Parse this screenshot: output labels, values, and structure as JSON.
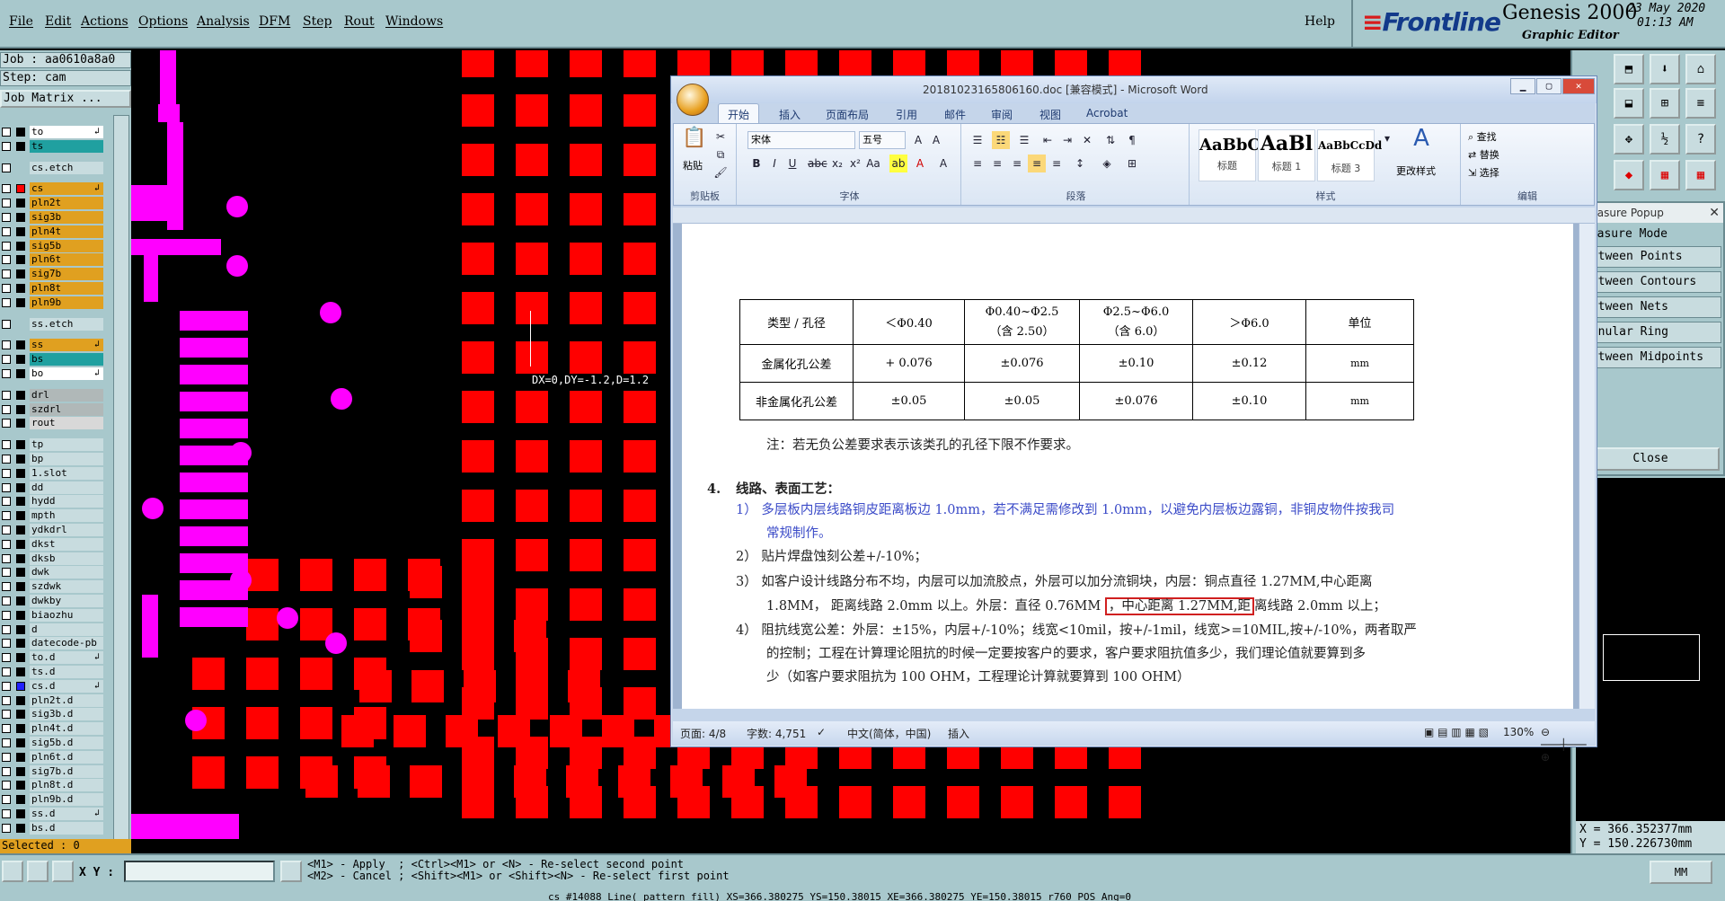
{
  "menu": [
    "File",
    "Edit",
    "Actions",
    "Options",
    "Analysis",
    "DFM",
    "Step",
    "Rout",
    "Windows"
  ],
  "help": "Help",
  "brand": {
    "logo": "Frontline",
    "title": "Genesis 2000",
    "subtitle": "Graphic Editor",
    "date": "23 May 2020",
    "time": "01:13 AM"
  },
  "job": {
    "job": "Job : aa0610a8a0",
    "step": "Step: cam",
    "matrix": "Job Matrix ..."
  },
  "layers": [
    {
      "name": "to",
      "color": "#ffffff",
      "arrow": true,
      "dot": "#000000"
    },
    {
      "name": "ts",
      "color": "#20a0a0",
      "arrow": false,
      "dot": "#000000"
    },
    {
      "name": "",
      "color": "#a8c8cc",
      "arrow": false,
      "dot": ""
    },
    {
      "name": "cs.etch",
      "color": "#c8dcdf",
      "arrow": false,
      "dot": ""
    },
    {
      "name": "",
      "color": "#a8c8cc",
      "arrow": false,
      "dot": ""
    },
    {
      "name": "cs",
      "color": "#e0a020",
      "arrow": true,
      "dot": "#ff0000"
    },
    {
      "name": "pln2t",
      "color": "#e0a020",
      "arrow": false,
      "dot": "#000000"
    },
    {
      "name": "sig3b",
      "color": "#e0a020",
      "arrow": false,
      "dot": "#000000"
    },
    {
      "name": "pln4t",
      "color": "#e0a020",
      "arrow": false,
      "dot": "#000000"
    },
    {
      "name": "sig5b",
      "color": "#e0a020",
      "arrow": false,
      "dot": "#000000"
    },
    {
      "name": "pln6t",
      "color": "#e0a020",
      "arrow": false,
      "dot": "#000000"
    },
    {
      "name": "sig7b",
      "color": "#e0a020",
      "arrow": false,
      "dot": "#000000"
    },
    {
      "name": "pln8t",
      "color": "#e0a020",
      "arrow": false,
      "dot": "#000000"
    },
    {
      "name": "pln9b",
      "color": "#e0a020",
      "arrow": false,
      "dot": "#000000"
    },
    {
      "name": "",
      "color": "#a8c8cc",
      "arrow": false,
      "dot": ""
    },
    {
      "name": "ss.etch",
      "color": "#c8dcdf",
      "arrow": false,
      "dot": ""
    },
    {
      "name": "",
      "color": "#a8c8cc",
      "arrow": false,
      "dot": ""
    },
    {
      "name": "ss",
      "color": "#e0a020",
      "arrow": true,
      "dot": "#000000"
    },
    {
      "name": "bs",
      "color": "#20a0a0",
      "arrow": false,
      "dot": "#000000"
    },
    {
      "name": "bo",
      "color": "#ffffff",
      "arrow": true,
      "dot": "#000000"
    },
    {
      "name": "",
      "color": "#a8c8cc",
      "arrow": false,
      "dot": ""
    },
    {
      "name": "drl",
      "color": "#b0b8b8",
      "arrow": false,
      "dot": "#000000"
    },
    {
      "name": "szdrl",
      "color": "#b0b8b8",
      "arrow": false,
      "dot": "#000000"
    },
    {
      "name": "rout",
      "color": "#d8d8d8",
      "arrow": false,
      "dot": "#000000"
    },
    {
      "name": "",
      "color": "#a8c8cc",
      "arrow": false,
      "dot": ""
    },
    {
      "name": "tp",
      "color": "#c8dcdf",
      "arrow": false,
      "dot": "#000000"
    },
    {
      "name": "bp",
      "color": "#c8dcdf",
      "arrow": false,
      "dot": "#000000"
    },
    {
      "name": "1.slot",
      "color": "#c8dcdf",
      "arrow": false,
      "dot": "#000000"
    },
    {
      "name": "dd",
      "color": "#c8dcdf",
      "arrow": false,
      "dot": "#000000"
    },
    {
      "name": "hydd",
      "color": "#c8dcdf",
      "arrow": false,
      "dot": "#000000"
    },
    {
      "name": "mpth",
      "color": "#c8dcdf",
      "arrow": false,
      "dot": "#000000"
    },
    {
      "name": "ydkdrl",
      "color": "#c8dcdf",
      "arrow": false,
      "dot": "#000000"
    },
    {
      "name": "dkst",
      "color": "#c8dcdf",
      "arrow": false,
      "dot": "#000000"
    },
    {
      "name": "dksb",
      "color": "#c8dcdf",
      "arrow": false,
      "dot": "#000000"
    },
    {
      "name": "dwk",
      "color": "#c8dcdf",
      "arrow": false,
      "dot": "#000000"
    },
    {
      "name": "szdwk",
      "color": "#c8dcdf",
      "arrow": false,
      "dot": "#000000"
    },
    {
      "name": "dwkby",
      "color": "#c8dcdf",
      "arrow": false,
      "dot": "#000000"
    },
    {
      "name": "biaozhu",
      "color": "#c8dcdf",
      "arrow": false,
      "dot": "#000000"
    },
    {
      "name": "d",
      "color": "#c8dcdf",
      "arrow": false,
      "dot": "#000000"
    },
    {
      "name": "datecode-pb",
      "color": "#c8dcdf",
      "arrow": false,
      "dot": "#000000"
    },
    {
      "name": "to.d",
      "color": "#c8dcdf",
      "arrow": true,
      "dot": "#000000"
    },
    {
      "name": "ts.d",
      "color": "#c8dcdf",
      "arrow": false,
      "dot": "#000000"
    },
    {
      "name": "cs.d",
      "color": "#c8dcdf",
      "arrow": true,
      "dot": "#2020ff"
    },
    {
      "name": "pln2t.d",
      "color": "#c8dcdf",
      "arrow": false,
      "dot": "#000000"
    },
    {
      "name": "sig3b.d",
      "color": "#c8dcdf",
      "arrow": false,
      "dot": "#000000"
    },
    {
      "name": "pln4t.d",
      "color": "#c8dcdf",
      "arrow": false,
      "dot": "#000000"
    },
    {
      "name": "sig5b.d",
      "color": "#c8dcdf",
      "arrow": false,
      "dot": "#000000"
    },
    {
      "name": "pln6t.d",
      "color": "#c8dcdf",
      "arrow": false,
      "dot": "#000000"
    },
    {
      "name": "sig7b.d",
      "color": "#c8dcdf",
      "arrow": false,
      "dot": "#000000"
    },
    {
      "name": "pln8t.d",
      "color": "#c8dcdf",
      "arrow": false,
      "dot": "#000000"
    },
    {
      "name": "pln9b.d",
      "color": "#c8dcdf",
      "arrow": false,
      "dot": "#000000"
    },
    {
      "name": "ss.d",
      "color": "#c8dcdf",
      "arrow": true,
      "dot": "#000000"
    },
    {
      "name": "bs.d",
      "color": "#c8dcdf",
      "arrow": false,
      "dot": "#000000"
    }
  ],
  "selected": "Selected : 0",
  "measure_text": "DX=0,DY=-1.2,D=1.2",
  "xy_label": "X Y :",
  "hints": "<M1> - Apply  ; <Ctrl><M1> or <N> - Re-select second point\n<M2> - Cancel ; <Shift><M1> or <Shift><N> - Re-select first point",
  "status_line": "cs #14088 Line( pattern fill) XS=366.380275 YS=150.38015 XE=366.380275 YE=150.38015 r760 POS Ang=0",
  "units_button": "MM",
  "measure_popup": {
    "title": "Measure Popup",
    "options": [
      "Measure Mode",
      "Between Points",
      "Between Contours",
      "Between Nets",
      "Annular Ring",
      "Between Midpoints"
    ],
    "close": "Close"
  },
  "coords": {
    "x": "X = 366.352377mm",
    "y": "Y = 150.226730mm"
  },
  "word": {
    "title": "20181023165806160.doc [兼容模式] - Microsoft Word",
    "tabs": [
      "开始",
      "插入",
      "页面布局",
      "引用",
      "邮件",
      "审阅",
      "视图",
      "Acrobat"
    ],
    "groups": {
      "clipboard": "剪贴板",
      "font": "字体",
      "paragraph": "段落",
      "styles": "样式",
      "editing": "编辑"
    },
    "paste": "粘贴",
    "font_name": "宋体",
    "font_size": "五号",
    "styles": [
      {
        "preview": "AaBbC",
        "name": "标题"
      },
      {
        "preview": "AaBl",
        "name": "标题 1"
      },
      {
        "preview": "AaBbCcDd",
        "name": "标题 3"
      }
    ],
    "change_styles": "更改样式",
    "find": "查找",
    "replace": "替换",
    "select": "选择",
    "table": {
      "header": [
        "类型 / 孔径",
        "＜Φ0.40",
        "Φ0.40~Φ2.5\n（含 2.50）",
        "Φ2.5~Φ6.0\n（含 6.0）",
        "＞Φ6.0",
        "单位"
      ],
      "rows": [
        [
          "金属化孔公差",
          "+ 0.076",
          "±0.076",
          "±0.10",
          "±0.12",
          "mm"
        ],
        [
          "非金属化孔公差",
          "±0.05",
          "±0.05",
          "±0.076",
          "±0.10",
          "mm"
        ]
      ]
    },
    "note": "注：若无负公差要求表示该类孔的孔径下限不作要求。",
    "heading_num": "4.",
    "heading": "线路、表面工艺：",
    "p1a": "1） 多层板内层线路铜皮距离板边 1.0mm，若不满足需修改到 1.0mm，以避免内层板边露铜，非铜皮物件按我司",
    "p1b": "常规制作。",
    "p2": "2） 贴片焊盘蚀刻公差+/-10%；",
    "p3a": "3） 如客户设计线路分布不均，内层可以加流胶点，外层可以加分流铜块，内层：铜点直径 1.27MM,中心距离",
    "p3b_pre": "1.8MM， 距离线路 2.0mm 以上。外层：直径 0.76MM",
    "p3b_hl": "，中心距离 1.27MM,距",
    "p3b_post": "离线路 2.0mm 以上；",
    "p4a": "4） 阻抗线宽公差：外层：±15%，内层+/-10%；线宽<10mil，按+/-1mil，线宽>=10MIL,按+/-10%，两者取严",
    "p4b": "的控制；工程在计算理论阻抗的时候一定要按客户的要求，客户要求阻抗值多少，我们理论值就要算到多",
    "p4c": "少（如客户要求阻抗为 100 OHM，工程理论计算就要算到 100 OHM）",
    "status": {
      "page": "页面: 4/8",
      "words": "字数: 4,751",
      "lang": "中文(简体，中国)",
      "mode": "插入",
      "zoom": "130%"
    }
  }
}
